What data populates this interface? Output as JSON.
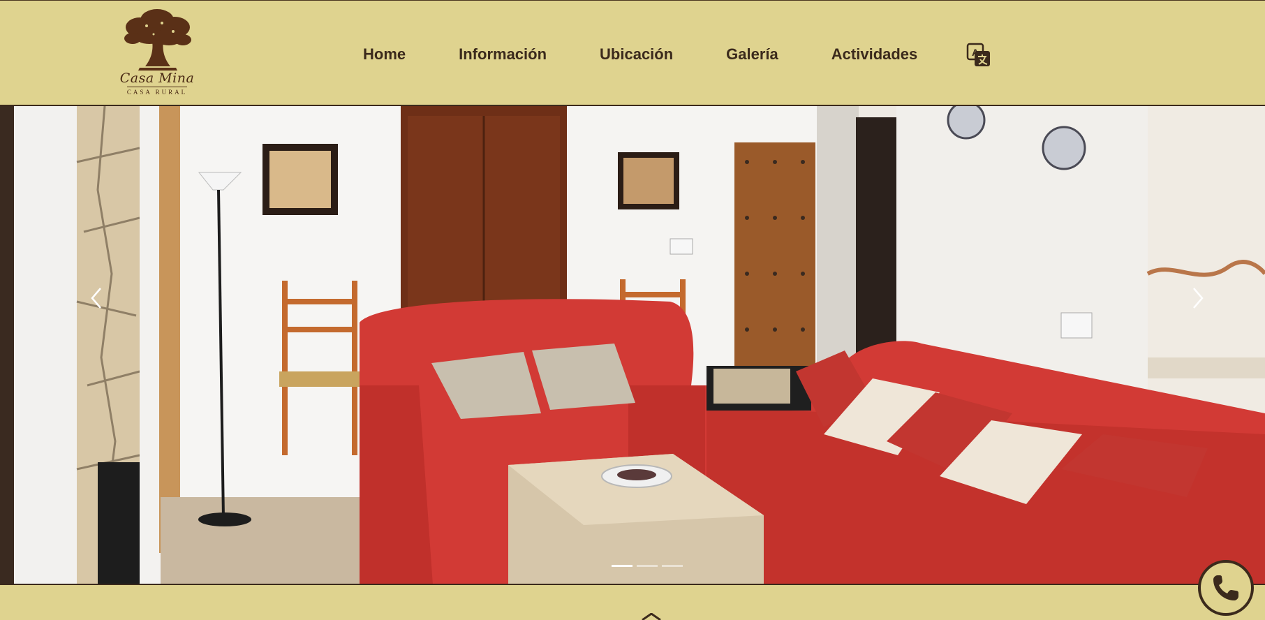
{
  "brand": {
    "name": "Casa Mina",
    "subtitle": "CASA RURAL",
    "logo_icon": "tree-icon"
  },
  "nav": {
    "items": [
      {
        "label": "Home"
      },
      {
        "label": "Información"
      },
      {
        "label": "Ubicación"
      },
      {
        "label": "Galería"
      },
      {
        "label": "Actividades"
      }
    ],
    "translate_icon": "translate-icon"
  },
  "carousel": {
    "prev_icon": "chevron-left-icon",
    "next_icon": "chevron-right-icon",
    "slide_count": 3,
    "active_slide": 1
  },
  "floating": {
    "phone_icon": "phone-icon",
    "home_icon": "home-icon"
  },
  "colors": {
    "header_bg": "#dfd38f",
    "text_dark": "#3b2a1c",
    "accent_red": "#d23a35"
  }
}
